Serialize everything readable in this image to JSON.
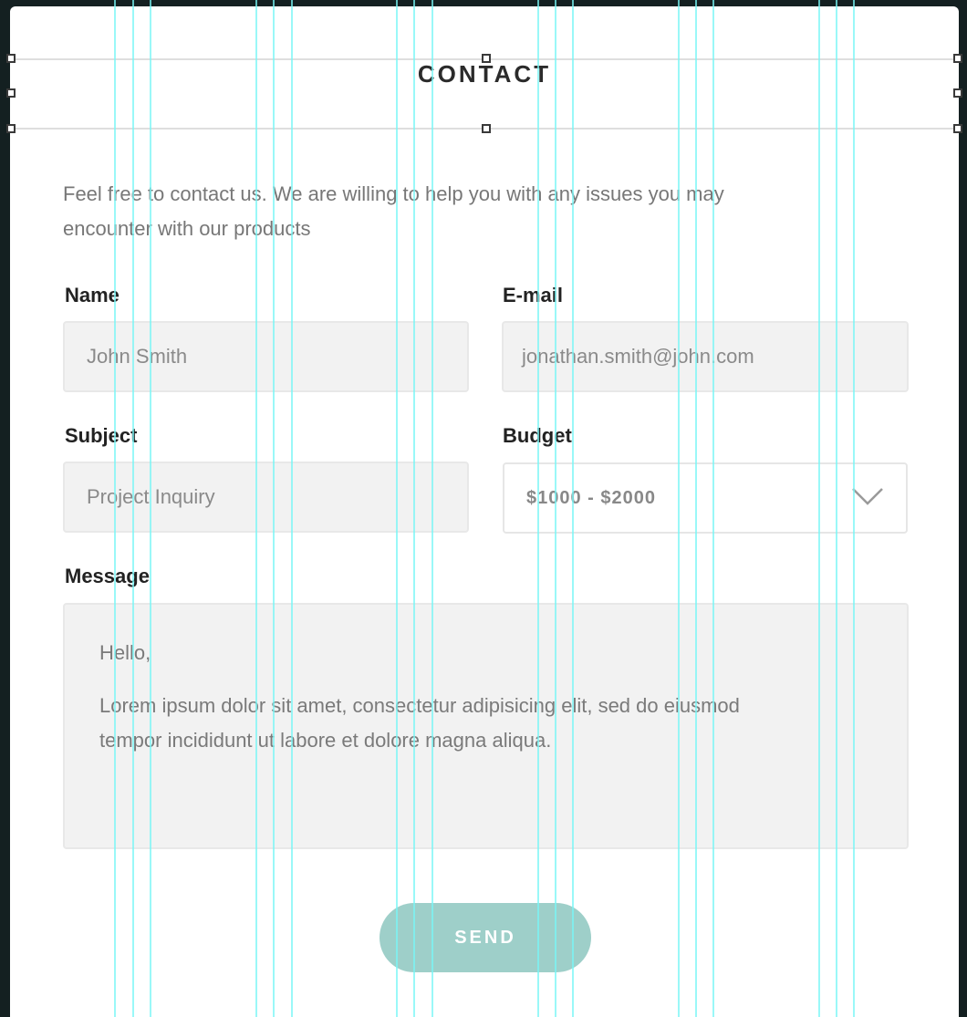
{
  "header": {
    "title": "CONTACT"
  },
  "intro": {
    "line1": "Feel free to contact us. We are willing to help you with any issues you may",
    "line2": "encounter with our products"
  },
  "form": {
    "name": {
      "label": "Name",
      "value": "John Smith"
    },
    "email": {
      "label": "E-mail",
      "value": "jonathan.smith@john.com"
    },
    "subject": {
      "label": "Subject",
      "value": "Project Inquiry"
    },
    "budget": {
      "label": "Budget",
      "selected": "$1000 - $2000",
      "icon": "chevron-down-icon"
    },
    "message": {
      "label": "Message",
      "greeting": "Hello,",
      "body_line1": "Lorem ipsum dolor sit amet, consectetur adipisicing elit, sed do eiusmod",
      "body_line2": "tempor incididunt ut labore et dolore magna aliqua."
    },
    "send_label": "SEND"
  },
  "colors": {
    "accent": "#9ecfc9",
    "guide": "#78f5f5",
    "background": "#142021"
  }
}
